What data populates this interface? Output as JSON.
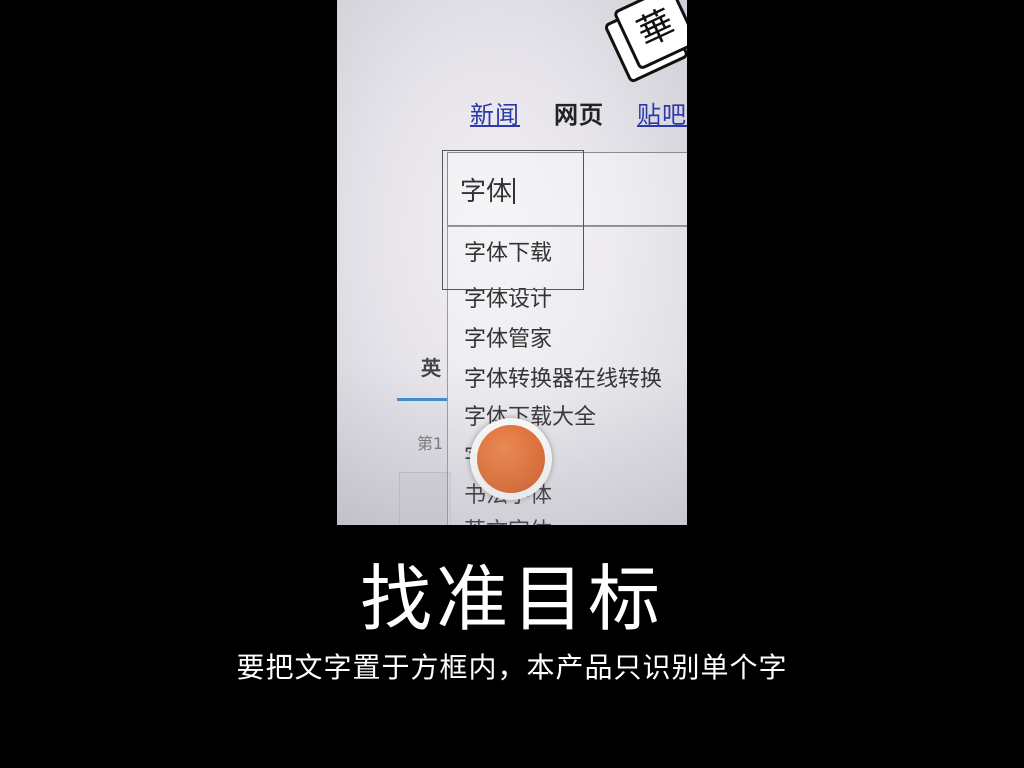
{
  "viewfinder": {
    "nav": [
      "新闻",
      "网页",
      "贴吧"
    ],
    "search_value": "字体",
    "suggestions": [
      "字体下载",
      "字体设计",
      "字体管家",
      "字体转换器在线转换",
      "字体下载大全",
      "字体",
      "书法字体",
      "英文字体"
    ],
    "side_tab": "英",
    "side_page": "第1",
    "logo_glyph": "華"
  },
  "title": "找准目标",
  "subtitle": "要把文字置于方框内，本产品只识别单个字",
  "colors": {
    "background": "#000000",
    "shutter_outer": "#ffffff",
    "shutter_inner": "#e66a2c",
    "link": "#2a3aa8"
  }
}
